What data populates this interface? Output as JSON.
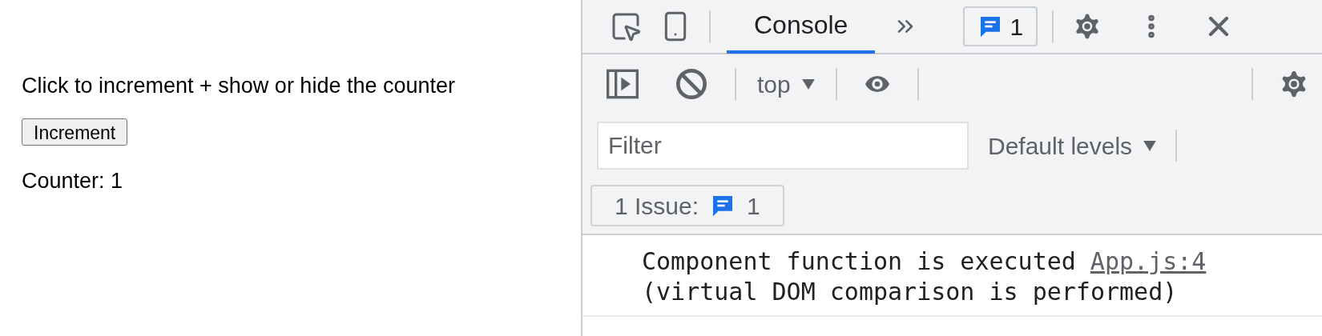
{
  "page": {
    "description": "Click to increment + show or hide the counter",
    "button": "Increment",
    "counter": "Counter: 1"
  },
  "devtools": {
    "tabs": [
      {
        "label": "Console",
        "selected": true
      }
    ],
    "issues_badge": "1",
    "console_toolbar": {
      "context": "top"
    },
    "filter": {
      "placeholder": "Filter",
      "levels": "Default levels"
    },
    "issues": {
      "label": "1 Issue:",
      "count": "1"
    },
    "messages": [
      {
        "lines": [
          "Component function is executed",
          "(virtual DOM comparison is performed)"
        ],
        "source": "App.js:4"
      }
    ]
  }
}
